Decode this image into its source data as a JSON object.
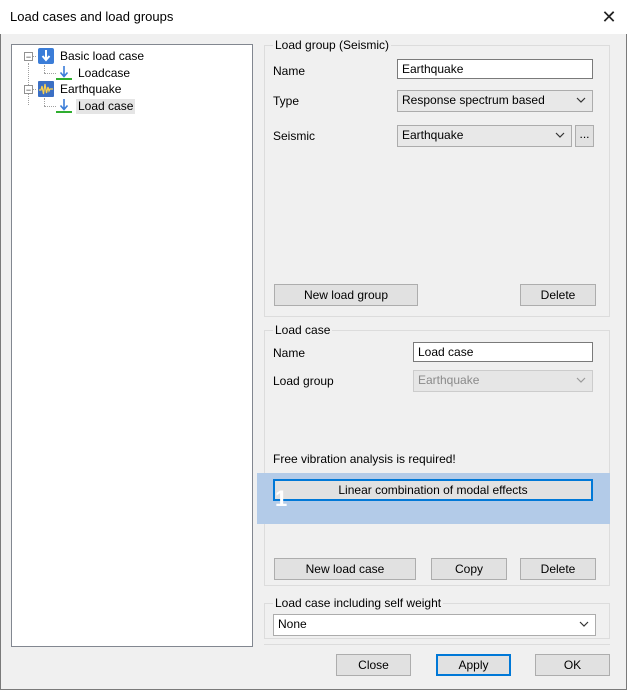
{
  "window": {
    "title": "Load cases and load groups",
    "close_glyph": "✕"
  },
  "tree": {
    "items": [
      {
        "label": "Basic load case",
        "expander": "−",
        "icon": "load-arrow-icon"
      },
      {
        "label": "Loadcase",
        "icon": "load-case-icon"
      },
      {
        "label": "Earthquake",
        "expander": "−",
        "icon": "seismic-icon"
      },
      {
        "label": "Load case",
        "icon": "load-case-icon",
        "selected": true
      }
    ]
  },
  "load_group": {
    "legend": "Load group (Seismic)",
    "name_label": "Name",
    "name_value": "Earthquake",
    "type_label": "Type",
    "type_value": "Response spectrum based",
    "seismic_label": "Seismic",
    "seismic_value": "Earthquake",
    "browse_label": "...",
    "new_button": "New load group",
    "delete_button": "Delete"
  },
  "load_case": {
    "legend": "Load case",
    "name_label": "Name",
    "name_value": "Load case",
    "group_label": "Load group",
    "group_value": "Earthquake",
    "notice": "Free vibration analysis is required!",
    "modal_button": "Linear combination of modal effects",
    "badge": "1",
    "new_button": "New load case",
    "copy_button": "Copy",
    "delete_button": "Delete"
  },
  "self_weight": {
    "legend": "Load case including self weight",
    "value": "None"
  },
  "footer": {
    "close": "Close",
    "apply": "Apply",
    "ok": "OK"
  },
  "colors": {
    "highlight": "#b3cbe8",
    "accent": "#0078d7",
    "load_arrow": "#3b7dd8",
    "ground_line": "#2fae2f"
  }
}
